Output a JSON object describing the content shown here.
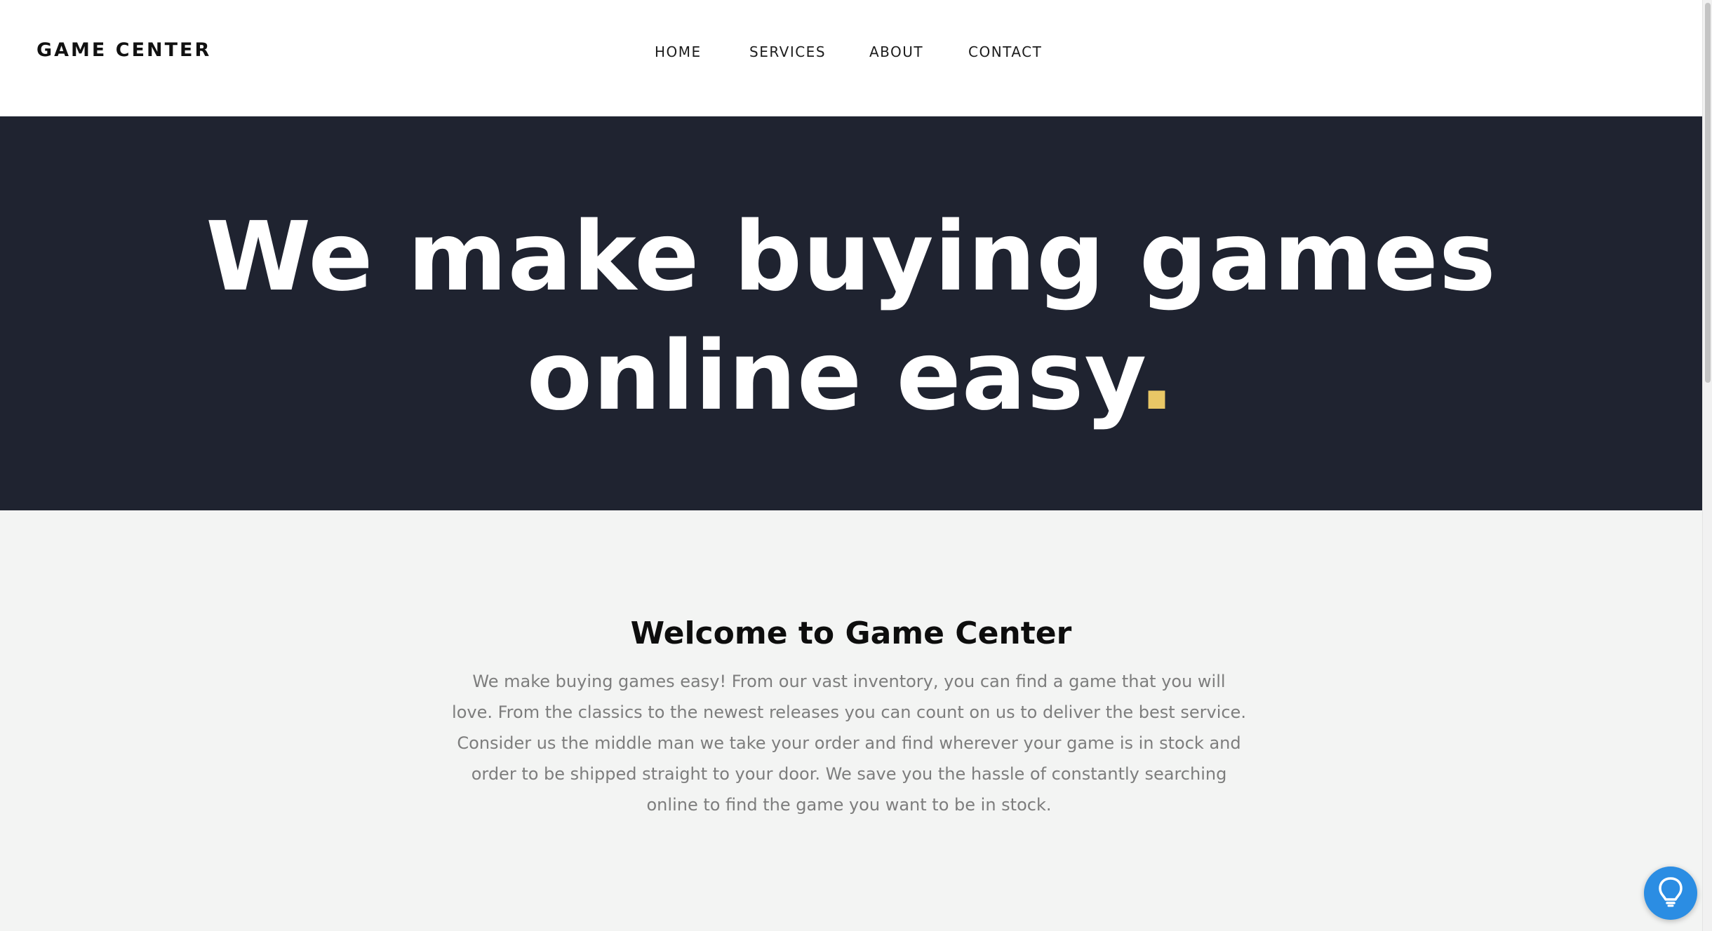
{
  "header": {
    "brand": "GAME CENTER",
    "nav": [
      {
        "label": "HOME"
      },
      {
        "label": "SERVICES"
      },
      {
        "label": "ABOUT"
      },
      {
        "label": "CONTACT"
      }
    ]
  },
  "hero": {
    "line1": "We make buying games",
    "line2": "online easy",
    "dot": ".",
    "accent_color": "#e9c766",
    "background_color": "#1f2330"
  },
  "welcome": {
    "title": "Welcome to Game Center",
    "body": "We make buying games easy! From our vast inventory, you can find a game that you will love. From the classics to the newest releases you can count on us to deliver the best service. Consider us the middle man we take your order and find wherever your game is in stock and order to be shipped straight to your door. We save you the hassle of constantly searching online to find the game you want to be in stock."
  },
  "help_widget": {
    "icon": "lightbulb-icon",
    "color": "#2b8de3"
  }
}
